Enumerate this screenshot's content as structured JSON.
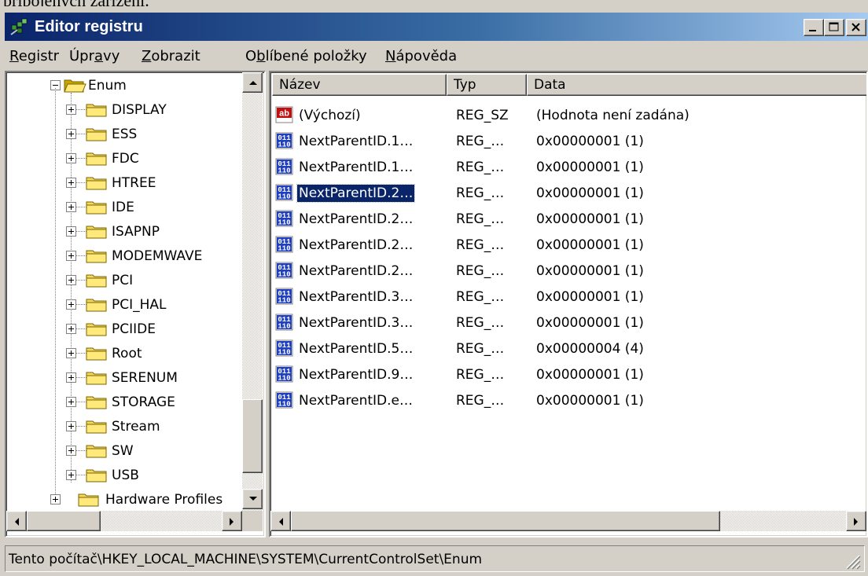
{
  "page": {
    "doc_text": "připojených zařízení."
  },
  "window": {
    "title": "Editor registru"
  },
  "menu": [
    {
      "pre": "",
      "ul": "R",
      "post": "egistr"
    },
    {
      "pre": "Úpr",
      "ul": "a",
      "post": "vy"
    },
    {
      "pre": "",
      "ul": "Z",
      "post": "obrazit"
    },
    {
      "pre": "O",
      "ul": "b",
      "post": "líbené položky"
    },
    {
      "pre": "",
      "ul": "N",
      "post": "ápověda"
    }
  ],
  "tree": {
    "parent": "Enum",
    "items": [
      "DISPLAY",
      "ESS",
      "FDC",
      "HTREE",
      "IDE",
      "ISAPNP",
      "MODEMWAVE",
      "PCI",
      "PCI_HAL",
      "PCIIDE",
      "Root",
      "SERENUM",
      "STORAGE",
      "Stream",
      "SW",
      "USB"
    ],
    "next": "Hardware Profiles"
  },
  "list": {
    "columns": [
      "Název",
      "Typ",
      "Data"
    ],
    "rows": [
      {
        "icon": "string-value-icon",
        "name": "(Výchozí)",
        "type": "REG_SZ",
        "data": "(Hodnota není zadána)"
      },
      {
        "icon": "binary-value-icon",
        "name": "NextParentID.1…",
        "type": "REG_…",
        "data": "0x00000001 (1)"
      },
      {
        "icon": "binary-value-icon",
        "name": "NextParentID.1…",
        "type": "REG_…",
        "data": "0x00000001 (1)"
      },
      {
        "icon": "binary-value-icon",
        "name": "NextParentID.2…",
        "type": "REG_…",
        "data": "0x00000001 (1)",
        "selected": true
      },
      {
        "icon": "binary-value-icon",
        "name": "NextParentID.2…",
        "type": "REG_…",
        "data": "0x00000001 (1)"
      },
      {
        "icon": "binary-value-icon",
        "name": "NextParentID.2…",
        "type": "REG_…",
        "data": "0x00000001 (1)"
      },
      {
        "icon": "binary-value-icon",
        "name": "NextParentID.2…",
        "type": "REG_…",
        "data": "0x00000001 (1)"
      },
      {
        "icon": "binary-value-icon",
        "name": "NextParentID.3…",
        "type": "REG_…",
        "data": "0x00000001 (1)"
      },
      {
        "icon": "binary-value-icon",
        "name": "NextParentID.3…",
        "type": "REG_…",
        "data": "0x00000001 (1)"
      },
      {
        "icon": "binary-value-icon",
        "name": "NextParentID.5…",
        "type": "REG_…",
        "data": "0x00000004 (4)"
      },
      {
        "icon": "binary-value-icon",
        "name": "NextParentID.9…",
        "type": "REG_…",
        "data": "0x00000001 (1)"
      },
      {
        "icon": "binary-value-icon",
        "name": "NextParentID.e…",
        "type": "REG_…",
        "data": "0x00000001 (1)"
      }
    ]
  },
  "status": {
    "path": "Tento počítač\\HKEY_LOCAL_MACHINE\\SYSTEM\\CurrentControlSet\\Enum"
  },
  "colors": {
    "title_start": "#0a246a",
    "title_end": "#a6caf0",
    "face": "#d4d0c8",
    "selection": "#0a246a"
  }
}
